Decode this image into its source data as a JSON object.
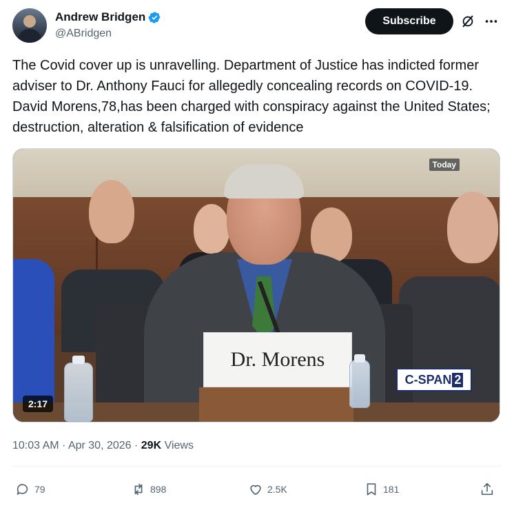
{
  "author": {
    "display_name": "Andrew Bridgen",
    "handle": "@ABridgen",
    "verified_color": "#1d9bf0"
  },
  "header": {
    "subscribe_label": "Subscribe"
  },
  "tweet": {
    "text": "The Covid cover up is unravelling. Department of Justice has indicted former adviser to Dr. Anthony Fauci for allegedly concealing records on COVID-19. David Morens,78,has been charged with conspiracy against the United States; destruction, alteration & falsification of evidence"
  },
  "media": {
    "nameplate": "Dr. Morens",
    "today_badge": "Today",
    "network_text": "C-SPAN",
    "network_num": "2",
    "duration": "2:17"
  },
  "meta": {
    "timestamp": "10:03 AM · Apr 30, 2026 · ",
    "views_count": "29K",
    "views_label": " Views"
  },
  "actions": {
    "replies": "79",
    "reposts": "898",
    "likes": "2.5K",
    "bookmarks": "181"
  }
}
